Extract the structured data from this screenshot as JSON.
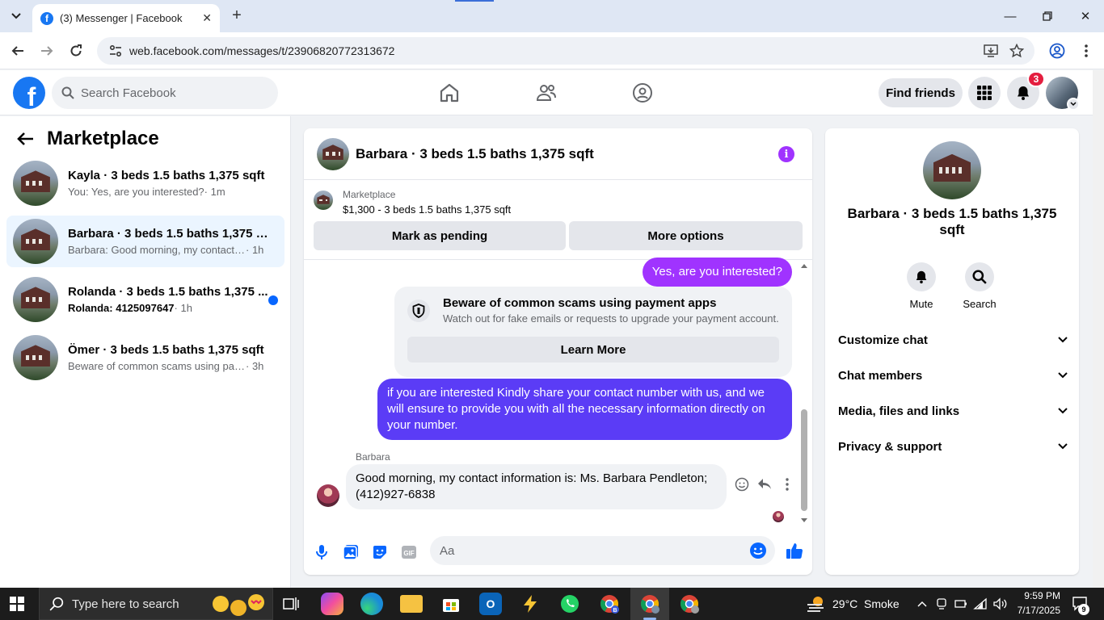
{
  "browser": {
    "tab_title": "(3) Messenger | Facebook",
    "url": "web.facebook.com/messages/t/23906820772313672"
  },
  "facebook": {
    "search_placeholder": "Search Facebook",
    "find_friends": "Find friends",
    "notification_count": "3"
  },
  "sidebar": {
    "title": "Marketplace",
    "conversations": [
      {
        "name": "Kayla · 3 beds 1.5 baths 1,375 sqft",
        "preview": "You: Yes, are you interested?",
        "time": " · 1m",
        "active": false,
        "unread": false
      },
      {
        "name": "Barbara · 3 beds 1.5 baths 1,375 sqft",
        "preview": "Barbara: Good morning, my contact in...",
        "time": " · 1h",
        "active": true,
        "unread": false
      },
      {
        "name": "Rolanda · 3 beds 1.5 baths 1,375 ...",
        "preview": "Rolanda: 4125097647",
        "time": " · 1h",
        "active": false,
        "unread": true
      },
      {
        "name": "Ömer · 3 beds 1.5 baths 1,375 sqft",
        "preview": "Beware of common scams using pay...",
        "time": " · 3h",
        "active": false,
        "unread": false
      }
    ]
  },
  "chat": {
    "title": "Barbara · 3 beds 1.5 baths 1,375 sqft",
    "listing_source": "Marketplace",
    "listing_summary": "$1,300 - 3 beds 1.5 baths 1,375 sqft",
    "mark_pending": "Mark as pending",
    "more_options": "More options",
    "messages": {
      "out_1": "Yes, are you interested?",
      "scam_title": "Beware of common scams using payment apps",
      "scam_desc": "Watch out for fake emails or requests to upgrade your payment account.",
      "learn_more": "Learn More",
      "out_2": "if you are interested Kindly share your contact number with us, and we will ensure to provide you with all the necessary information directly on your number.",
      "sender_name": "Barbara",
      "in_1": "Good morning, my contact information is: Ms. Barbara Pendleton; (412)927-6838"
    },
    "composer_placeholder": "Aa"
  },
  "info_panel": {
    "title": "Barbara · 3 beds 1.5 baths 1,375 sqft",
    "mute": "Mute",
    "search": "Search",
    "rows": [
      "Customize chat",
      "Chat members",
      "Media, files and links",
      "Privacy & support"
    ]
  },
  "taskbar": {
    "search_placeholder": "Type here to search",
    "weather": "29°C  Smoke",
    "time": "9:59 PM",
    "date": "7/17/2025",
    "notification_count": "9"
  },
  "colors": {
    "fb_blue": "#1877f2",
    "bubble_purple": "#a033ff",
    "bubble_indigo": "#5b3cf6",
    "unread_blue": "#0866ff",
    "badge_red": "#e41e3f"
  }
}
